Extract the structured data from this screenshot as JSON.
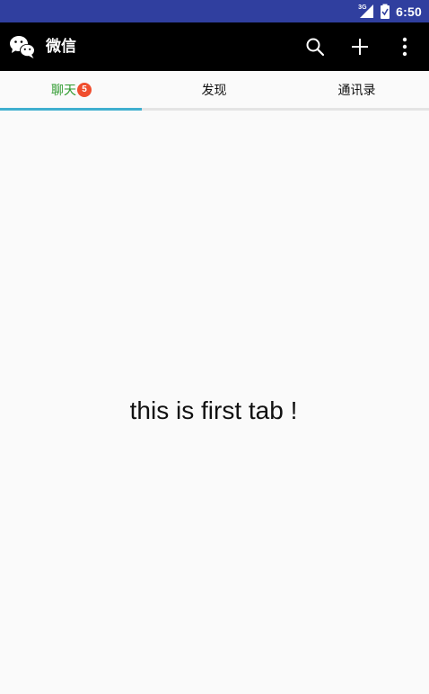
{
  "status_bar": {
    "network_label": "3G",
    "time": "6:50",
    "background_color": "#303F9F"
  },
  "app_bar": {
    "title": "微信",
    "logo_icon": "wechat-logo-icon",
    "actions": [
      "search-icon",
      "add-icon",
      "more-vert-icon"
    ],
    "background_color": "#000000"
  },
  "tabs": {
    "items": [
      {
        "label": "聊天",
        "badge": "5",
        "active": true
      },
      {
        "label": "发现",
        "active": false
      },
      {
        "label": "通讯录",
        "active": false
      }
    ],
    "active_color": "#2E9A2E",
    "indicator_color": "#40AFCF",
    "badge_color": "#F04E2E"
  },
  "content": {
    "message": "this is first tab !"
  }
}
